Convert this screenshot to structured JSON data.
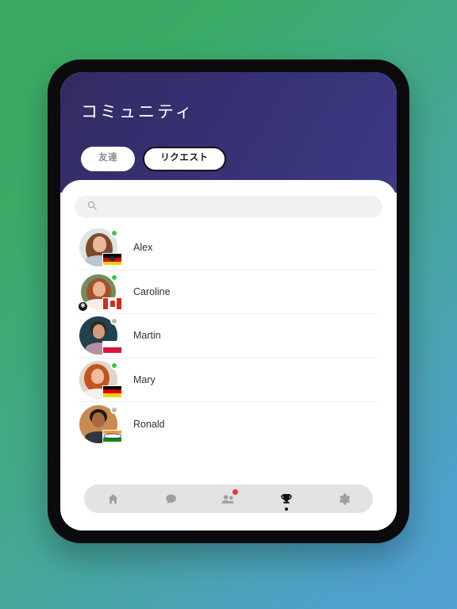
{
  "background": {
    "from": "#3aa862",
    "to": "#52a0d4"
  },
  "device": {
    "bezel_color": "#0b0b0d"
  },
  "header": {
    "title": "コミュニティ",
    "gradient_from": "#332c62",
    "gradient_to": "#3c3a84",
    "tabs": [
      {
        "label": "友達",
        "active": false
      },
      {
        "label": "リクエスト",
        "active": true
      }
    ]
  },
  "search": {
    "icon": "search-icon",
    "value": "",
    "placeholder": ""
  },
  "friends": [
    {
      "name": "Alex",
      "status": "online",
      "status_color": "#3ec63e",
      "country": "Germany",
      "flag": "de",
      "story_ring": false,
      "badge": null,
      "avatar": {
        "bg": "#dfe3e1",
        "skin": "#e8b99a",
        "hair": "#7d4a2c",
        "cloth": "#b9c6cd"
      }
    },
    {
      "name": "Caroline",
      "status": "online",
      "status_color": "#3ec63e",
      "country": "Canada",
      "flag": "ca",
      "story_ring": true,
      "ring_color": "#ffd400",
      "badge": "star-badge",
      "avatar": {
        "bg": "#6f8f5e",
        "skin": "#e9b48f",
        "hair": "#a54f2e",
        "cloth": "#f3eee7"
      }
    },
    {
      "name": "Martin",
      "status": "offline",
      "status_color": "#b6b6b6",
      "country": "Poland",
      "flag": "pl",
      "story_ring": false,
      "badge": null,
      "avatar": {
        "bg": "#21414f",
        "skin": "#d79a78",
        "hair": "#2f2823",
        "cloth": "#b78fa4"
      }
    },
    {
      "name": "Mary",
      "status": "online",
      "status_color": "#3ec63e",
      "country": "Germany",
      "flag": "de",
      "story_ring": false,
      "badge": null,
      "avatar": {
        "bg": "#ddd6cd",
        "skin": "#eebd9c",
        "hair": "#c2541f",
        "cloth": "#f4f0ea"
      }
    },
    {
      "name": "Ronald",
      "status": "offline",
      "status_color": "#b6b6b6",
      "country": "India",
      "flag": "in",
      "story_ring": false,
      "badge": null,
      "avatar": {
        "bg": "#c98a52",
        "skin": "#a96a43",
        "hair": "#1d1a18",
        "cloth": "#2d3742"
      }
    }
  ],
  "bottom_nav": {
    "items": [
      {
        "icon": "home-icon",
        "label": "Home",
        "active": false,
        "notification": false
      },
      {
        "icon": "chat-bubble-icon",
        "label": "Chat",
        "active": false,
        "notification": false
      },
      {
        "icon": "people-icon",
        "label": "Community",
        "active": false,
        "notification": true
      },
      {
        "icon": "trophy-icon",
        "label": "Leaderboard",
        "active": true,
        "notification": false
      },
      {
        "icon": "gear-icon",
        "label": "Settings",
        "active": false,
        "notification": false
      }
    ]
  }
}
